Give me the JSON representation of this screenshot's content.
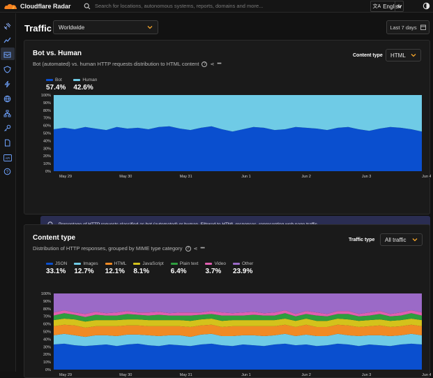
{
  "app": {
    "brand": "Cloudflare Radar",
    "search_placeholder": "Search for locations, autonomous systems, reports, domains and more...",
    "language": "English",
    "page_title": "Traffic",
    "region": "Worldwide",
    "date_range": "Last 7 days"
  },
  "sidebar_icons": [
    "satellite-icon",
    "traffic-trend-icon",
    "inbox-icon",
    "shield-icon",
    "lightning-icon",
    "globe-icon",
    "network-icon",
    "key-icon",
    "document-icon",
    "api-icon",
    "help-icon"
  ],
  "bot_card": {
    "title": "Bot vs. Human",
    "subtitle": "Bot (automated) vs. human HTTP requests distribution to HTML content",
    "control_label": "Content type",
    "control_value": "HTML",
    "info_text": "Percentage of HTTP requests classified as bot (automated) or human. Filtered to HTML responses, representing web page traffic."
  },
  "content_card": {
    "title": "Content type",
    "subtitle": "Distribution of HTTP responses, grouped by MIME type category",
    "control_label": "Traffic type",
    "control_value": "All traffic"
  },
  "colors": {
    "bot": "#0a4fcf",
    "human": "#6fcbe6",
    "json": "#0a4fcf",
    "images": "#6fcbe6",
    "html": "#f08a24",
    "javascript": "#d4c21b",
    "plain_text": "#2e9e3e",
    "video": "#e05fb0",
    "other": "#9b6ac7"
  },
  "chart_data": [
    {
      "type": "area",
      "stacked": true,
      "title": "Bot vs. Human",
      "x": [
        "May 29",
        "May 30",
        "May 31",
        "Jun 1",
        "Jun 2",
        "Jun 3",
        "Jun 4"
      ],
      "ylim": [
        0,
        100
      ],
      "yticks": [
        "100%",
        "90%",
        "80%",
        "70%",
        "60%",
        "50%",
        "40%",
        "30%",
        "20%",
        "10%",
        "0%"
      ],
      "series": [
        {
          "name": "Bot",
          "summary": "57.4%",
          "values": [
            55,
            57,
            55,
            58,
            56,
            54,
            58,
            56,
            57,
            55,
            58,
            59,
            56,
            54,
            57,
            59,
            55,
            52,
            55,
            58,
            57,
            54,
            55,
            58,
            57,
            56,
            54,
            57,
            58,
            55,
            53,
            56,
            58,
            57,
            55,
            52
          ]
        },
        {
          "name": "Human",
          "summary": "42.6%",
          "values": [
            45,
            43,
            45,
            42,
            44,
            46,
            42,
            44,
            43,
            45,
            42,
            41,
            44,
            46,
            43,
            41,
            45,
            48,
            45,
            42,
            43,
            46,
            45,
            42,
            43,
            44,
            46,
            43,
            42,
            45,
            47,
            44,
            42,
            43,
            45,
            48
          ]
        }
      ],
      "legend": "top-left",
      "grid": false
    },
    {
      "type": "area",
      "stacked": true,
      "title": "Content type",
      "x": [
        "May 29",
        "May 30",
        "May 31",
        "Jun 1",
        "Jun 2",
        "Jun 3",
        "Jun 4"
      ],
      "ylim": [
        0,
        100
      ],
      "yticks": [
        "100%",
        "90%",
        "80%",
        "70%",
        "60%",
        "50%",
        "40%",
        "30%",
        "20%",
        "10%",
        "0%"
      ],
      "series": [
        {
          "name": "JSON",
          "summary": "33.1%",
          "values": [
            33,
            34,
            32,
            31,
            32,
            33,
            31,
            33,
            34,
            32,
            31,
            33,
            32,
            31,
            33,
            34,
            32,
            31,
            33,
            32,
            31,
            33,
            34,
            32,
            33,
            31,
            32,
            34,
            33,
            31,
            33,
            32,
            31,
            33,
            34,
            33
          ]
        },
        {
          "name": "Images",
          "summary": "12.7%",
          "values": [
            12,
            13,
            13,
            12,
            13,
            12,
            13,
            13,
            12,
            13,
            13,
            12,
            13,
            12,
            13,
            13,
            12,
            13,
            12,
            13,
            13,
            12,
            13,
            12,
            13,
            13,
            12,
            13,
            12,
            13,
            12,
            13,
            13,
            12,
            13,
            12
          ]
        },
        {
          "name": "HTML",
          "summary": "12.1%",
          "values": [
            12,
            12,
            13,
            12,
            12,
            12,
            13,
            12,
            12,
            12,
            13,
            12,
            12,
            13,
            12,
            12,
            12,
            13,
            12,
            12,
            13,
            12,
            12,
            12,
            13,
            12,
            12,
            12,
            13,
            12,
            12,
            13,
            12,
            12,
            12,
            12
          ]
        },
        {
          "name": "JavaScript",
          "summary": "8.1%",
          "values": [
            8,
            8,
            8,
            8,
            8,
            8,
            8,
            8,
            8,
            8,
            8,
            8,
            8,
            8,
            8,
            8,
            8,
            8,
            8,
            8,
            8,
            8,
            8,
            8,
            8,
            8,
            8,
            8,
            8,
            8,
            8,
            8,
            8,
            8,
            8,
            8
          ]
        },
        {
          "name": "Plain text",
          "summary": "6.4%",
          "values": [
            6,
            7,
            6,
            6,
            7,
            6,
            6,
            7,
            6,
            6,
            7,
            6,
            6,
            7,
            6,
            6,
            7,
            6,
            6,
            7,
            6,
            6,
            7,
            6,
            6,
            7,
            6,
            6,
            7,
            6,
            6,
            7,
            6,
            6,
            7,
            6
          ]
        },
        {
          "name": "Video",
          "summary": "3.7%",
          "values": [
            4,
            4,
            3,
            4,
            4,
            3,
            4,
            4,
            3,
            4,
            4,
            3,
            4,
            4,
            3,
            4,
            4,
            3,
            4,
            4,
            3,
            4,
            4,
            3,
            4,
            4,
            3,
            4,
            4,
            3,
            4,
            4,
            3,
            4,
            4,
            4
          ]
        },
        {
          "name": "Other",
          "summary": "23.9%",
          "values": [
            25,
            22,
            25,
            27,
            24,
            26,
            25,
            23,
            25,
            25,
            24,
            26,
            25,
            25,
            25,
            23,
            25,
            26,
            25,
            24,
            26,
            26,
            22,
            27,
            23,
            25,
            27,
            24,
            23,
            27,
            26,
            23,
            27,
            25,
            22,
            25
          ]
        }
      ],
      "legend": "top-left",
      "grid": false
    }
  ]
}
